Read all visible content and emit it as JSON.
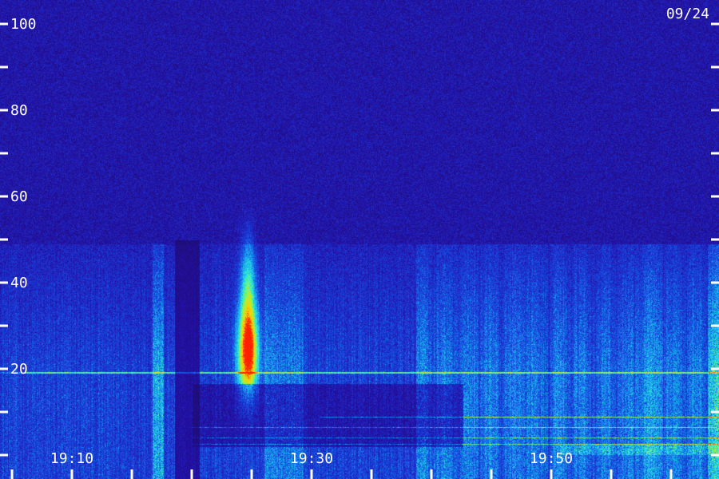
{
  "chart_data": {
    "type": "heatmap",
    "title": "",
    "xlabel": "",
    "ylabel": "",
    "date": "09/24",
    "ylim": [
      0,
      100
    ],
    "y_ticks": [
      {
        "value": 0,
        "label": ""
      },
      {
        "value": 10,
        "label": ""
      },
      {
        "value": 20,
        "label": "20"
      },
      {
        "value": 30,
        "label": ""
      },
      {
        "value": 40,
        "label": "40"
      },
      {
        "value": 50,
        "label": ""
      },
      {
        "value": 60,
        "label": "60"
      },
      {
        "value": 70,
        "label": ""
      },
      {
        "value": 80,
        "label": "80"
      },
      {
        "value": 90,
        "label": ""
      },
      {
        "value": 100,
        "label": "100"
      }
    ],
    "xlim": [
      "19:04",
      "19:64"
    ],
    "x_ticks": [
      {
        "value": "19:05",
        "label": ""
      },
      {
        "value": "19:10",
        "label": "19:10"
      },
      {
        "value": "19:15",
        "label": ""
      },
      {
        "value": "19:20",
        "label": ""
      },
      {
        "value": "19:25",
        "label": ""
      },
      {
        "value": "19:30",
        "label": "19:30"
      },
      {
        "value": "19:35",
        "label": ""
      },
      {
        "value": "19:40",
        "label": ""
      },
      {
        "value": "19:45",
        "label": ""
      },
      {
        "value": "19:50",
        "label": "19:50"
      },
      {
        "value": "19:55",
        "label": ""
      },
      {
        "value": "19:60",
        "label": ""
      }
    ],
    "colormap": [
      "#1a0c4a",
      "#2410a8",
      "#1846e0",
      "#18a8f0",
      "#30f0d0",
      "#b0f030",
      "#ffd000",
      "#ff2000"
    ],
    "grid": false
  }
}
